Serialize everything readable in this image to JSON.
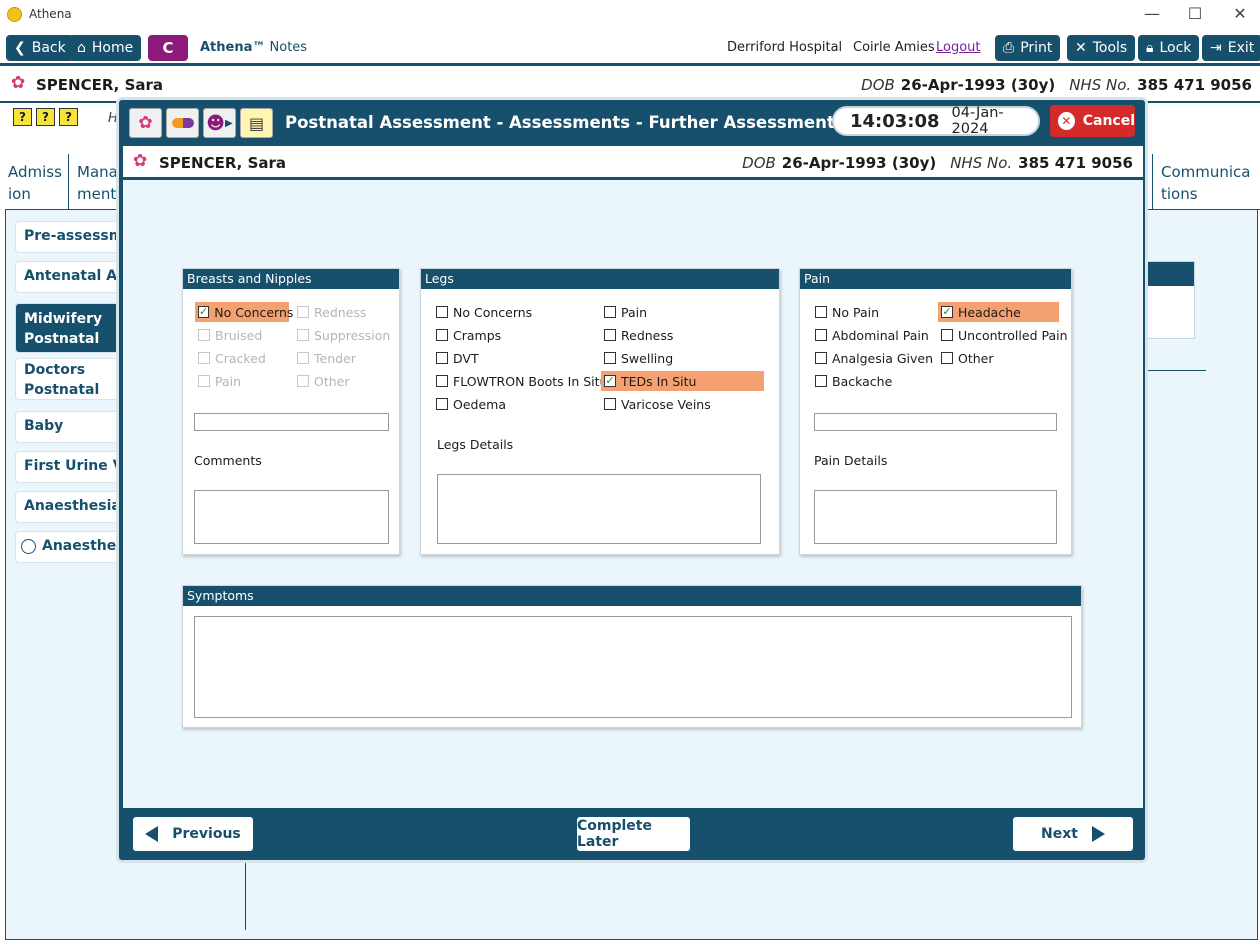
{
  "window": {
    "title": "Athena",
    "controls": {
      "minimize": "—",
      "maximize": "☐",
      "close": "✕"
    }
  },
  "toolbar": {
    "back": "Back",
    "home": "Home",
    "c_label": "C",
    "app_brand": "Athena™",
    "app_module": "Notes",
    "hospital": "Derriford Hospital",
    "user": "Coirle Amies",
    "logout": "Logout",
    "print": "Print",
    "tools": "Tools",
    "lock": "Lock",
    "exit": "Exit"
  },
  "patient": {
    "name": "SPENCER, Sara",
    "dob_label": "DOB",
    "dob": "26-Apr-1993 (30y)",
    "nhs_label": "NHS No.",
    "nhs": "385 471 9056"
  },
  "background": {
    "help_icons": [
      "?",
      "?",
      "?"
    ],
    "header_initial": "H",
    "tabs": [
      {
        "label": "Admiss ion"
      },
      {
        "label": "Mana ment"
      },
      {
        "label": "Communica tions"
      }
    ],
    "side_items": [
      "Pre-assessment",
      "Antenatal Assessments",
      "Midwifery Postnatal Assessments",
      "Doctors Postnatal Assessments",
      "Baby",
      "First Urine Void",
      "Anaesthesia Information",
      "Anaesthesia"
    ]
  },
  "modal": {
    "title": "Postnatal Assessment - Assessments - Further Assessment",
    "time": "14:03:08",
    "date": "04-Jan-2024",
    "cancel": "Cancel",
    "panels": {
      "breasts": {
        "title": "Breasts and Nipples",
        "options": [
          {
            "label": "No Concerns",
            "checked": true,
            "disabled": false
          },
          {
            "label": "Redness",
            "checked": false,
            "disabled": true
          },
          {
            "label": "Bruised",
            "checked": false,
            "disabled": true
          },
          {
            "label": "Suppression",
            "checked": false,
            "disabled": true
          },
          {
            "label": "Cracked",
            "checked": false,
            "disabled": true
          },
          {
            "label": "Tender",
            "checked": false,
            "disabled": true
          },
          {
            "label": "Pain",
            "checked": false,
            "disabled": true
          },
          {
            "label": "Other",
            "checked": false,
            "disabled": true
          }
        ],
        "comments_label": "Comments"
      },
      "legs": {
        "title": "Legs",
        "options": [
          {
            "label": "No Concerns",
            "checked": false
          },
          {
            "label": "Pain",
            "checked": false
          },
          {
            "label": "Cramps",
            "checked": false
          },
          {
            "label": "Redness",
            "checked": false
          },
          {
            "label": "DVT",
            "checked": false
          },
          {
            "label": "Swelling",
            "checked": false
          },
          {
            "label": "FLOWTRON Boots In Situ",
            "checked": false
          },
          {
            "label": "TEDs In Situ",
            "checked": true
          },
          {
            "label": "Oedema",
            "checked": false
          },
          {
            "label": "Varicose Veins",
            "checked": false
          }
        ],
        "details_label": "Legs Details"
      },
      "pain": {
        "title": "Pain",
        "options": [
          {
            "label": "No Pain",
            "checked": false
          },
          {
            "label": "Headache",
            "checked": true
          },
          {
            "label": "Abdominal Pain",
            "checked": false
          },
          {
            "label": "Uncontrolled Pain",
            "checked": false
          },
          {
            "label": "Analgesia Given",
            "checked": false
          },
          {
            "label": "Other",
            "checked": false
          },
          {
            "label": "Backache",
            "checked": false
          }
        ],
        "details_label": "Pain Details"
      },
      "symptoms": {
        "title": "Symptoms"
      }
    },
    "footer": {
      "previous": "Previous",
      "complete_later": "Complete Later",
      "next": "Next"
    }
  }
}
